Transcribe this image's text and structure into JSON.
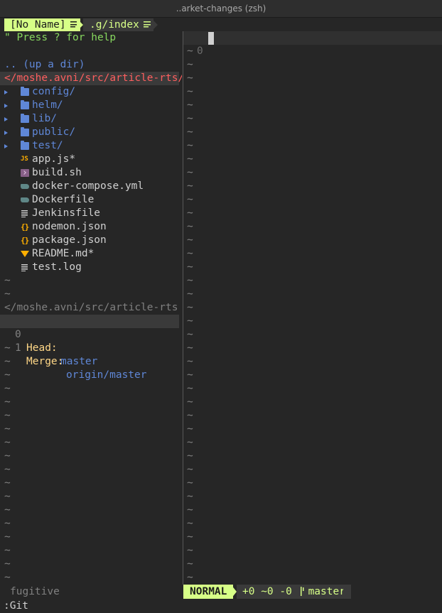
{
  "window": {
    "title": "..arket-changes (zsh)"
  },
  "tabs": [
    {
      "label": "[No Name]",
      "icon": "lines-icon",
      "active": true
    },
    {
      "label": ".g/index",
      "icon": "lines-icon",
      "active": false
    }
  ],
  "file_tree": {
    "help": "\" Press ? for help",
    "up_dir": ".. (up a dir)",
    "current_dir": "</moshe.avni/src/article-rts/",
    "entries": [
      {
        "name": "config/",
        "type": "dir",
        "icon": "folder-icon"
      },
      {
        "name": "helm/",
        "type": "dir",
        "icon": "folder-icon"
      },
      {
        "name": "lib/",
        "type": "dir",
        "icon": "folder-icon"
      },
      {
        "name": "public/",
        "type": "dir",
        "icon": "folder-icon"
      },
      {
        "name": "test/",
        "type": "dir",
        "icon": "folder-icon"
      },
      {
        "name": "app.js*",
        "type": "file",
        "icon": "js-icon"
      },
      {
        "name": "build.sh",
        "type": "file",
        "icon": "shell-icon"
      },
      {
        "name": "docker-compose.yml",
        "type": "file",
        "icon": "docker-icon"
      },
      {
        "name": "Dockerfile",
        "type": "file",
        "icon": "docker-icon"
      },
      {
        "name": "Jenkinsfile",
        "type": "file",
        "icon": "document-icon"
      },
      {
        "name": "nodemon.json",
        "type": "file",
        "icon": "json-icon"
      },
      {
        "name": "package.json",
        "type": "file",
        "icon": "json-icon"
      },
      {
        "name": "README.md*",
        "type": "file",
        "icon": "markdown-icon"
      },
      {
        "name": "test.log",
        "type": "file",
        "icon": "document-icon"
      }
    ],
    "empty_marker": "~"
  },
  "git_status": {
    "path": "</moshe.avni/src/article-rts",
    "lines": [
      {
        "num": "0",
        "key": "Head:",
        "value": "master",
        "selected": true
      },
      {
        "num": "1",
        "key": "Merge:",
        "value": "origin/master",
        "selected": false
      }
    ]
  },
  "editor": {
    "line_number": "0",
    "empty_marker": "~"
  },
  "statusline": {
    "left": "fugitive",
    "mode": "NORMAL",
    "git_summary": "+0 ~0 -0",
    "branch_icon": "git-branch-icon",
    "branch": "master"
  },
  "command_line": ":Git",
  "colors": {
    "background": "#262626",
    "accent": "#d7ff87",
    "directory": "#5f87d7",
    "current_dir": "#ff5f5f",
    "help": "#87d75f",
    "git_key": "#ffd787",
    "icon_orange": "#ffaf00"
  }
}
